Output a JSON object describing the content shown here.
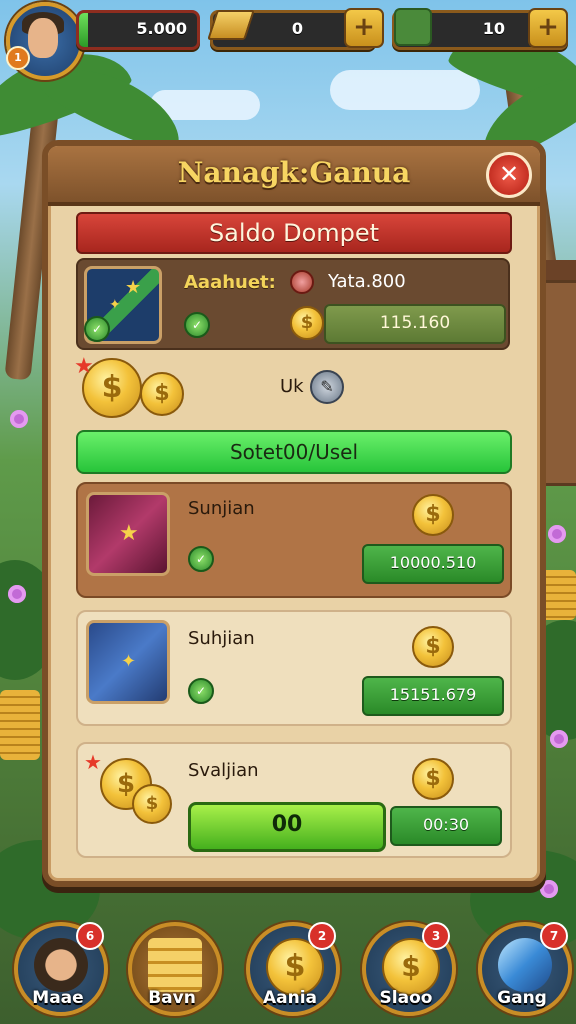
{
  "hud": {
    "energy_value": "5.000",
    "energy_fill": 0.08,
    "gold_value": "0",
    "gems_value": "10",
    "plus_glyph": "+",
    "level_badge": "1"
  },
  "panel": {
    "title": "Nanagk:Ganua",
    "close_glyph": "✕",
    "banner": "Saldo Dompet",
    "account_label": "Aaahuet:",
    "account_value": "Yata.800",
    "account_balance": "115.160",
    "uk_label": "Uk",
    "green_banner": "Sotet00/Usel",
    "rows": [
      {
        "title": "Sunjian",
        "amount": "10000.510"
      },
      {
        "title": "Suhjian",
        "amount": "15151.679"
      },
      {
        "title": "Svaljian",
        "button": "00",
        "amount": "00:30"
      }
    ]
  },
  "coin_glyph": "$",
  "bottom_nav": [
    {
      "label": "Maae",
      "badge": "6",
      "icon": "avatar-icon"
    },
    {
      "label": "Bavn",
      "badge": "",
      "icon": "gold-bars-icon"
    },
    {
      "label": "Aania",
      "badge": "2",
      "icon": "coin-icon"
    },
    {
      "label": "Slaoo",
      "badge": "3",
      "icon": "coin-pen-icon"
    },
    {
      "label": "Gang",
      "badge": "7",
      "icon": "quill-icon"
    }
  ],
  "colors": {
    "panel_bg": "#e9d2a6",
    "panel_border": "#7a4e27",
    "accent_gold": "#f7d562",
    "banner_red": "#d8453a",
    "banner_green": "#27c43a"
  }
}
